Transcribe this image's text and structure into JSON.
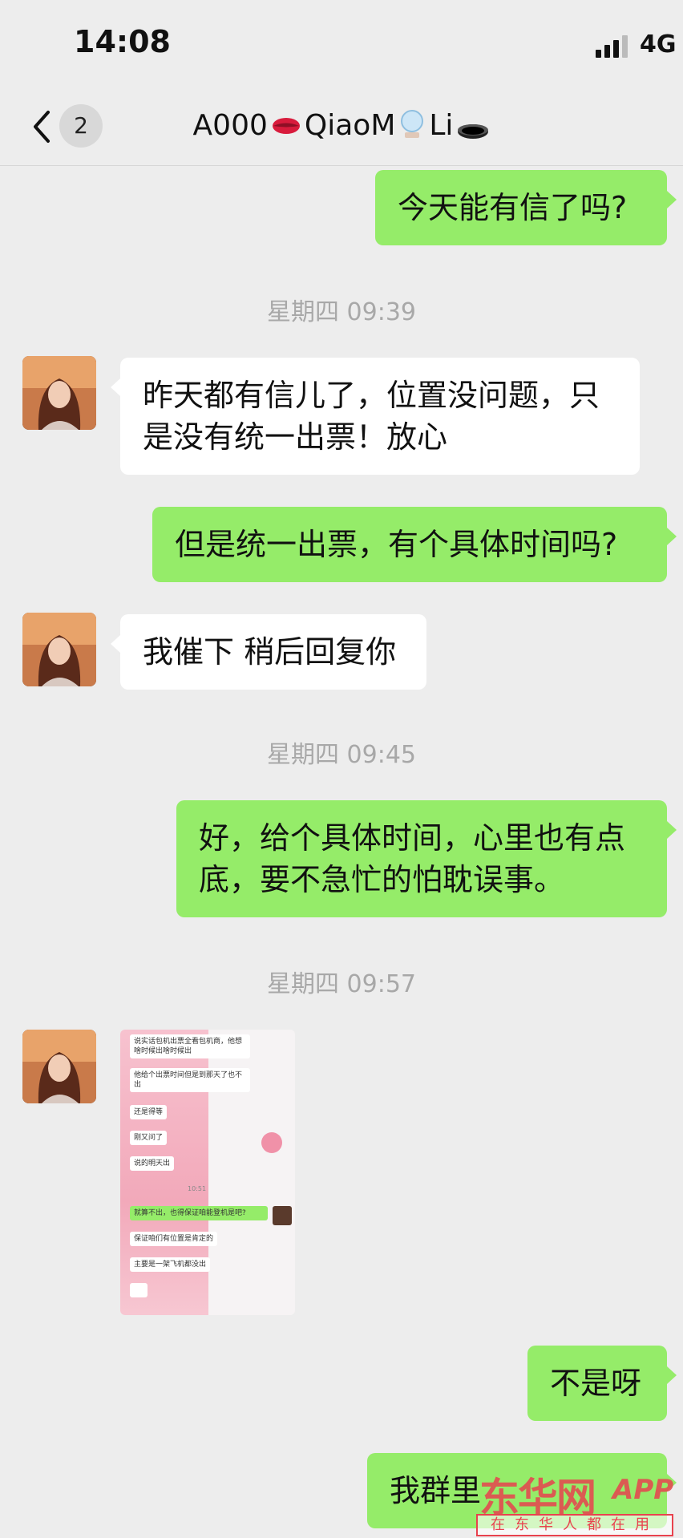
{
  "status_bar": {
    "time": "14:08",
    "network": "4G"
  },
  "nav": {
    "unread_count": "2",
    "title_parts": [
      "A000",
      "QiaoM",
      "Li"
    ]
  },
  "messages": [
    {
      "side": "out",
      "text": "今天能有信了吗?"
    },
    {
      "type": "timestamp",
      "text": "星期四 09:39"
    },
    {
      "side": "in",
      "lines": [
        "昨天都有信儿了，位置没问题，只",
        "是没有统一出票！放心"
      ]
    },
    {
      "side": "out",
      "text": "但是统一出票，有个具体时间吗?"
    },
    {
      "side": "in",
      "text": "我催下 稍后回复你"
    },
    {
      "type": "timestamp",
      "text": "星期四 09:45"
    },
    {
      "side": "out",
      "lines": [
        "好，给个具体时间，心里也有点",
        "底，要不急忙的怕耽误事。"
      ]
    },
    {
      "type": "timestamp",
      "text": "星期四 09:57"
    },
    {
      "side": "in",
      "type": "image"
    },
    {
      "side": "out",
      "text": "不是呀"
    },
    {
      "side": "out",
      "text": "我群里"
    }
  ],
  "screenshot_content": [
    "说实话包机出票全看包机商，他想啥时候出啥时候出",
    "他给个出票时间但是到那天了也不出",
    "还是得等",
    "刚又问了",
    "说的明天出",
    "10:51",
    "就算不出，也得保证咱能登机是吧?",
    "保证咱们有位置是肯定的",
    "主要是一架飞机都没出"
  ],
  "watermark": {
    "brand": "东华网",
    "app": "APP",
    "slogan": "在东华人都在用"
  },
  "colors": {
    "out_bubble": "#95ec69",
    "in_bubble": "#ffffff",
    "background": "#ededed",
    "timestamp": "#a8a8a8"
  }
}
